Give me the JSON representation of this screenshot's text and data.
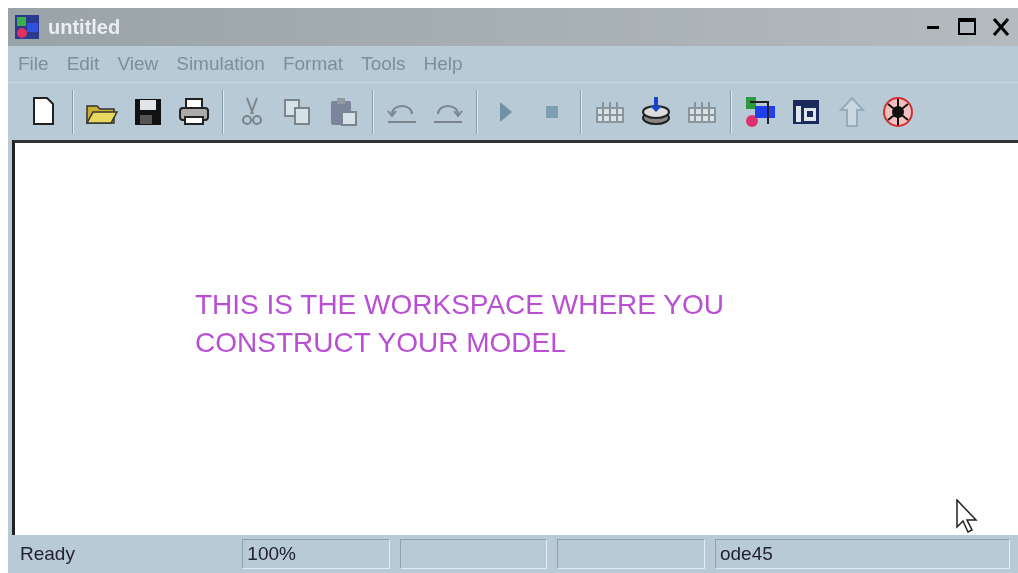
{
  "window": {
    "title": "untitled",
    "controls": [
      {
        "kind": "minimize"
      },
      {
        "kind": "maximize"
      },
      {
        "kind": "close"
      }
    ]
  },
  "menu": [
    {
      "label": "File"
    },
    {
      "label": "Edit"
    },
    {
      "label": "View"
    },
    {
      "label": "Simulation"
    },
    {
      "label": "Format"
    },
    {
      "label": "Tools"
    },
    {
      "label": "Help"
    }
  ],
  "toolbar": [
    {
      "kind": "new",
      "disabled": false
    },
    {
      "kind": "separator"
    },
    {
      "kind": "open",
      "disabled": false
    },
    {
      "kind": "save",
      "disabled": false
    },
    {
      "kind": "print",
      "disabled": false
    },
    {
      "kind": "separator"
    },
    {
      "kind": "cut",
      "disabled": true
    },
    {
      "kind": "copy",
      "disabled": true
    },
    {
      "kind": "paste",
      "disabled": true
    },
    {
      "kind": "separator"
    },
    {
      "kind": "undo",
      "disabled": true
    },
    {
      "kind": "redo",
      "disabled": true
    },
    {
      "kind": "separator"
    },
    {
      "kind": "start",
      "disabled": true
    },
    {
      "kind": "stop",
      "disabled": true
    },
    {
      "kind": "separator"
    },
    {
      "kind": "build",
      "disabled": true
    },
    {
      "kind": "update",
      "disabled": false
    },
    {
      "kind": "build",
      "disabled": true
    },
    {
      "kind": "separator"
    },
    {
      "kind": "library",
      "disabled": false
    },
    {
      "kind": "browser",
      "disabled": false
    },
    {
      "kind": "up",
      "disabled": true
    },
    {
      "kind": "debug",
      "disabled": false
    }
  ],
  "workspace": {
    "annotation": [
      "THIS IS THE WORKSPACE WHERE YOU",
      "CONSTRUCT YOUR MODEL"
    ]
  },
  "status_bar": [
    {
      "kind": "label",
      "text": "Ready"
    },
    {
      "kind": "pane",
      "text": "100%"
    },
    {
      "kind": "pane"
    },
    {
      "kind": "pane"
    },
    {
      "kind": "pane",
      "text": "ode45"
    }
  ]
}
